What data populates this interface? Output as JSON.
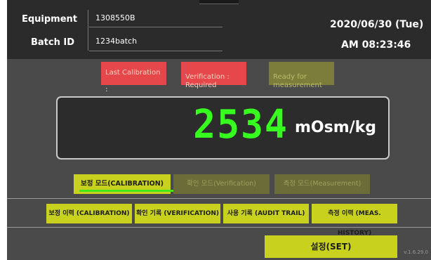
{
  "header": {
    "equipment_label": "Equipment",
    "equipment_value": "1308550B",
    "batch_label": "Batch ID",
    "batch_value": "1234batch",
    "date": "2020/06/30 (Tue)",
    "time": "AM 08:23:46"
  },
  "status": {
    "last_calibration": "Last Calibration :",
    "verification": "Verification :\nRequired",
    "ready": "Ready for\nmeasurement"
  },
  "display": {
    "reading": "2534",
    "unit": "mOsm/kg",
    "reading_color": "#36ff1f"
  },
  "modes": [
    {
      "label": "보정 모드(CALIBRATION)",
      "active": true
    },
    {
      "label": "확인 모드(Verification)",
      "active": false
    },
    {
      "label": "측정 모드(Measurement)",
      "active": false
    }
  ],
  "history_buttons": [
    {
      "label": "보정 이력 (CALIBRATION)"
    },
    {
      "label": "확인 기록 (VERIFICATION)"
    },
    {
      "label": "사용 기록 (AUDIT TRAIL)"
    },
    {
      "label": "측정 이력 (MEAS. HISTORY)"
    }
  ],
  "set_button": "설정(SET)",
  "version": "v.1.6.29.0",
  "colors": {
    "accent": "#c8d21e",
    "alert": "#e6474a",
    "background": "#4a4a4a",
    "header": "#2b2b2b"
  }
}
